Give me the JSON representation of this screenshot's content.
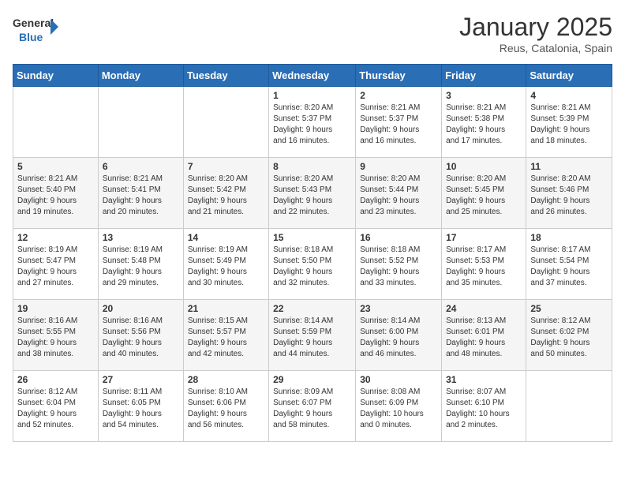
{
  "header": {
    "logo_general": "General",
    "logo_blue": "Blue",
    "month": "January 2025",
    "location": "Reus, Catalonia, Spain"
  },
  "weekdays": [
    "Sunday",
    "Monday",
    "Tuesday",
    "Wednesday",
    "Thursday",
    "Friday",
    "Saturday"
  ],
  "weeks": [
    {
      "days": [
        {
          "num": "",
          "info": ""
        },
        {
          "num": "",
          "info": ""
        },
        {
          "num": "",
          "info": ""
        },
        {
          "num": "1",
          "info": "Sunrise: 8:20 AM\nSunset: 5:37 PM\nDaylight: 9 hours\nand 16 minutes."
        },
        {
          "num": "2",
          "info": "Sunrise: 8:21 AM\nSunset: 5:37 PM\nDaylight: 9 hours\nand 16 minutes."
        },
        {
          "num": "3",
          "info": "Sunrise: 8:21 AM\nSunset: 5:38 PM\nDaylight: 9 hours\nand 17 minutes."
        },
        {
          "num": "4",
          "info": "Sunrise: 8:21 AM\nSunset: 5:39 PM\nDaylight: 9 hours\nand 18 minutes."
        }
      ]
    },
    {
      "days": [
        {
          "num": "5",
          "info": "Sunrise: 8:21 AM\nSunset: 5:40 PM\nDaylight: 9 hours\nand 19 minutes."
        },
        {
          "num": "6",
          "info": "Sunrise: 8:21 AM\nSunset: 5:41 PM\nDaylight: 9 hours\nand 20 minutes."
        },
        {
          "num": "7",
          "info": "Sunrise: 8:20 AM\nSunset: 5:42 PM\nDaylight: 9 hours\nand 21 minutes."
        },
        {
          "num": "8",
          "info": "Sunrise: 8:20 AM\nSunset: 5:43 PM\nDaylight: 9 hours\nand 22 minutes."
        },
        {
          "num": "9",
          "info": "Sunrise: 8:20 AM\nSunset: 5:44 PM\nDaylight: 9 hours\nand 23 minutes."
        },
        {
          "num": "10",
          "info": "Sunrise: 8:20 AM\nSunset: 5:45 PM\nDaylight: 9 hours\nand 25 minutes."
        },
        {
          "num": "11",
          "info": "Sunrise: 8:20 AM\nSunset: 5:46 PM\nDaylight: 9 hours\nand 26 minutes."
        }
      ]
    },
    {
      "days": [
        {
          "num": "12",
          "info": "Sunrise: 8:19 AM\nSunset: 5:47 PM\nDaylight: 9 hours\nand 27 minutes."
        },
        {
          "num": "13",
          "info": "Sunrise: 8:19 AM\nSunset: 5:48 PM\nDaylight: 9 hours\nand 29 minutes."
        },
        {
          "num": "14",
          "info": "Sunrise: 8:19 AM\nSunset: 5:49 PM\nDaylight: 9 hours\nand 30 minutes."
        },
        {
          "num": "15",
          "info": "Sunrise: 8:18 AM\nSunset: 5:50 PM\nDaylight: 9 hours\nand 32 minutes."
        },
        {
          "num": "16",
          "info": "Sunrise: 8:18 AM\nSunset: 5:52 PM\nDaylight: 9 hours\nand 33 minutes."
        },
        {
          "num": "17",
          "info": "Sunrise: 8:17 AM\nSunset: 5:53 PM\nDaylight: 9 hours\nand 35 minutes."
        },
        {
          "num": "18",
          "info": "Sunrise: 8:17 AM\nSunset: 5:54 PM\nDaylight: 9 hours\nand 37 minutes."
        }
      ]
    },
    {
      "days": [
        {
          "num": "19",
          "info": "Sunrise: 8:16 AM\nSunset: 5:55 PM\nDaylight: 9 hours\nand 38 minutes."
        },
        {
          "num": "20",
          "info": "Sunrise: 8:16 AM\nSunset: 5:56 PM\nDaylight: 9 hours\nand 40 minutes."
        },
        {
          "num": "21",
          "info": "Sunrise: 8:15 AM\nSunset: 5:57 PM\nDaylight: 9 hours\nand 42 minutes."
        },
        {
          "num": "22",
          "info": "Sunrise: 8:14 AM\nSunset: 5:59 PM\nDaylight: 9 hours\nand 44 minutes."
        },
        {
          "num": "23",
          "info": "Sunrise: 8:14 AM\nSunset: 6:00 PM\nDaylight: 9 hours\nand 46 minutes."
        },
        {
          "num": "24",
          "info": "Sunrise: 8:13 AM\nSunset: 6:01 PM\nDaylight: 9 hours\nand 48 minutes."
        },
        {
          "num": "25",
          "info": "Sunrise: 8:12 AM\nSunset: 6:02 PM\nDaylight: 9 hours\nand 50 minutes."
        }
      ]
    },
    {
      "days": [
        {
          "num": "26",
          "info": "Sunrise: 8:12 AM\nSunset: 6:04 PM\nDaylight: 9 hours\nand 52 minutes."
        },
        {
          "num": "27",
          "info": "Sunrise: 8:11 AM\nSunset: 6:05 PM\nDaylight: 9 hours\nand 54 minutes."
        },
        {
          "num": "28",
          "info": "Sunrise: 8:10 AM\nSunset: 6:06 PM\nDaylight: 9 hours\nand 56 minutes."
        },
        {
          "num": "29",
          "info": "Sunrise: 8:09 AM\nSunset: 6:07 PM\nDaylight: 9 hours\nand 58 minutes."
        },
        {
          "num": "30",
          "info": "Sunrise: 8:08 AM\nSunset: 6:09 PM\nDaylight: 10 hours\nand 0 minutes."
        },
        {
          "num": "31",
          "info": "Sunrise: 8:07 AM\nSunset: 6:10 PM\nDaylight: 10 hours\nand 2 minutes."
        },
        {
          "num": "",
          "info": ""
        }
      ]
    }
  ]
}
